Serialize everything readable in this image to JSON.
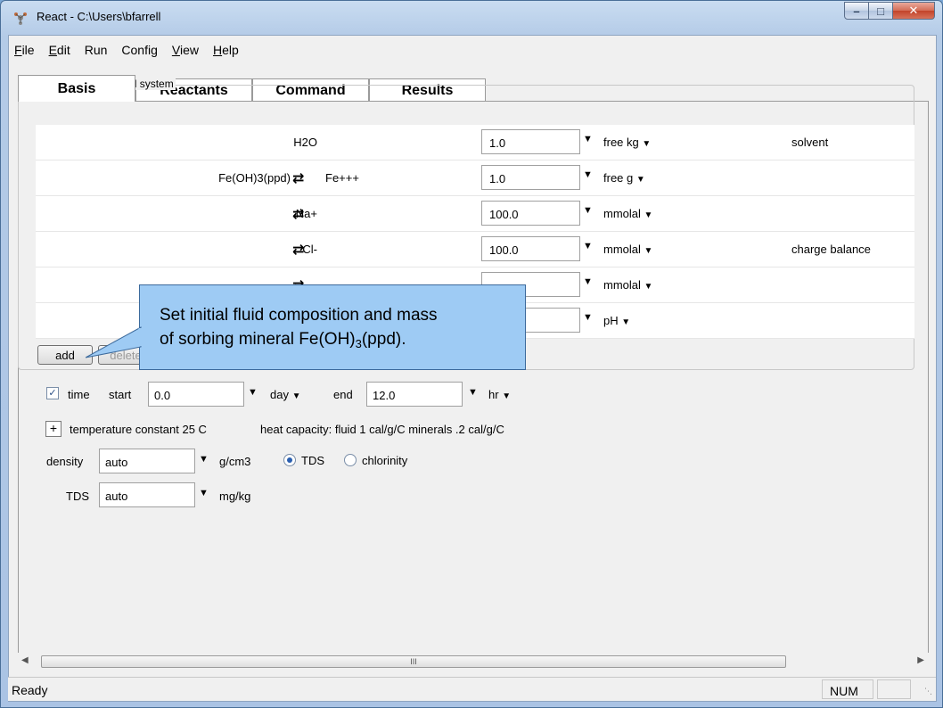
{
  "window": {
    "title": "React - C:\\Users\\bfarrell"
  },
  "menu": [
    {
      "label": "File",
      "u": "F",
      "rest": "ile"
    },
    {
      "label": "Edit",
      "u": "E",
      "rest": "dit"
    },
    {
      "label": "Run",
      "u": "",
      "rest": "Run"
    },
    {
      "label": "Config",
      "u": "",
      "rest": "Config"
    },
    {
      "label": "View",
      "u": "V",
      "rest": "iew"
    },
    {
      "label": "Help",
      "u": "H",
      "rest": "elp"
    }
  ],
  "tabs": [
    "Basis",
    "Reactants",
    "Command",
    "Results"
  ],
  "active_tab": "Basis",
  "group_label": "constraints on initial system",
  "rows": [
    {
      "species": "H2O",
      "swap": false,
      "partner": "",
      "value": "1.0",
      "unit": "free kg",
      "note": "solvent"
    },
    {
      "species": "Fe(OH)3(ppd)",
      "swap": true,
      "partner": "Fe+++",
      "value": "1.0",
      "unit": "free g",
      "note": ""
    },
    {
      "species": "Na+",
      "swap": true,
      "partner": "",
      "value": "100.0",
      "unit": "mmolal",
      "note": ""
    },
    {
      "species": "Cl-",
      "swap": true,
      "partner": "",
      "value": "100.0",
      "unit": "mmolal",
      "note": "charge balance"
    },
    {
      "species": "",
      "swap": true,
      "partner": "",
      "value": "",
      "unit": "mmolal",
      "note": ""
    },
    {
      "species": "",
      "swap": false,
      "partner": "",
      "value": "",
      "unit": "pH",
      "note": ""
    }
  ],
  "buttons": {
    "add": "add",
    "delete": "delete"
  },
  "time": {
    "label": "time",
    "start_label": "start",
    "start_value": "0.0",
    "start_unit": "day",
    "end_label": "end",
    "end_value": "12.0",
    "end_unit": "hr",
    "checked": true
  },
  "temperature": {
    "expander": "+",
    "text": "temperature  constant 25 C",
    "heat": "heat capacity:  fluid 1 cal/g/C   minerals .2 cal/g/C"
  },
  "density": {
    "label": "density",
    "value": "auto",
    "unit": "g/cm3",
    "opt1": "TDS",
    "opt2": "chlorinity",
    "selected": "TDS"
  },
  "tds": {
    "label": "TDS",
    "value": "auto",
    "unit": "mg/kg"
  },
  "scroll_grip": "III",
  "status": {
    "left": "Ready",
    "num": "NUM"
  },
  "callout": {
    "line1": "Set initial fluid composition and mass",
    "line2_pre": "of sorbing mineral Fe(OH)",
    "line2_sub": "3",
    "line2_post": "(ppd)."
  }
}
